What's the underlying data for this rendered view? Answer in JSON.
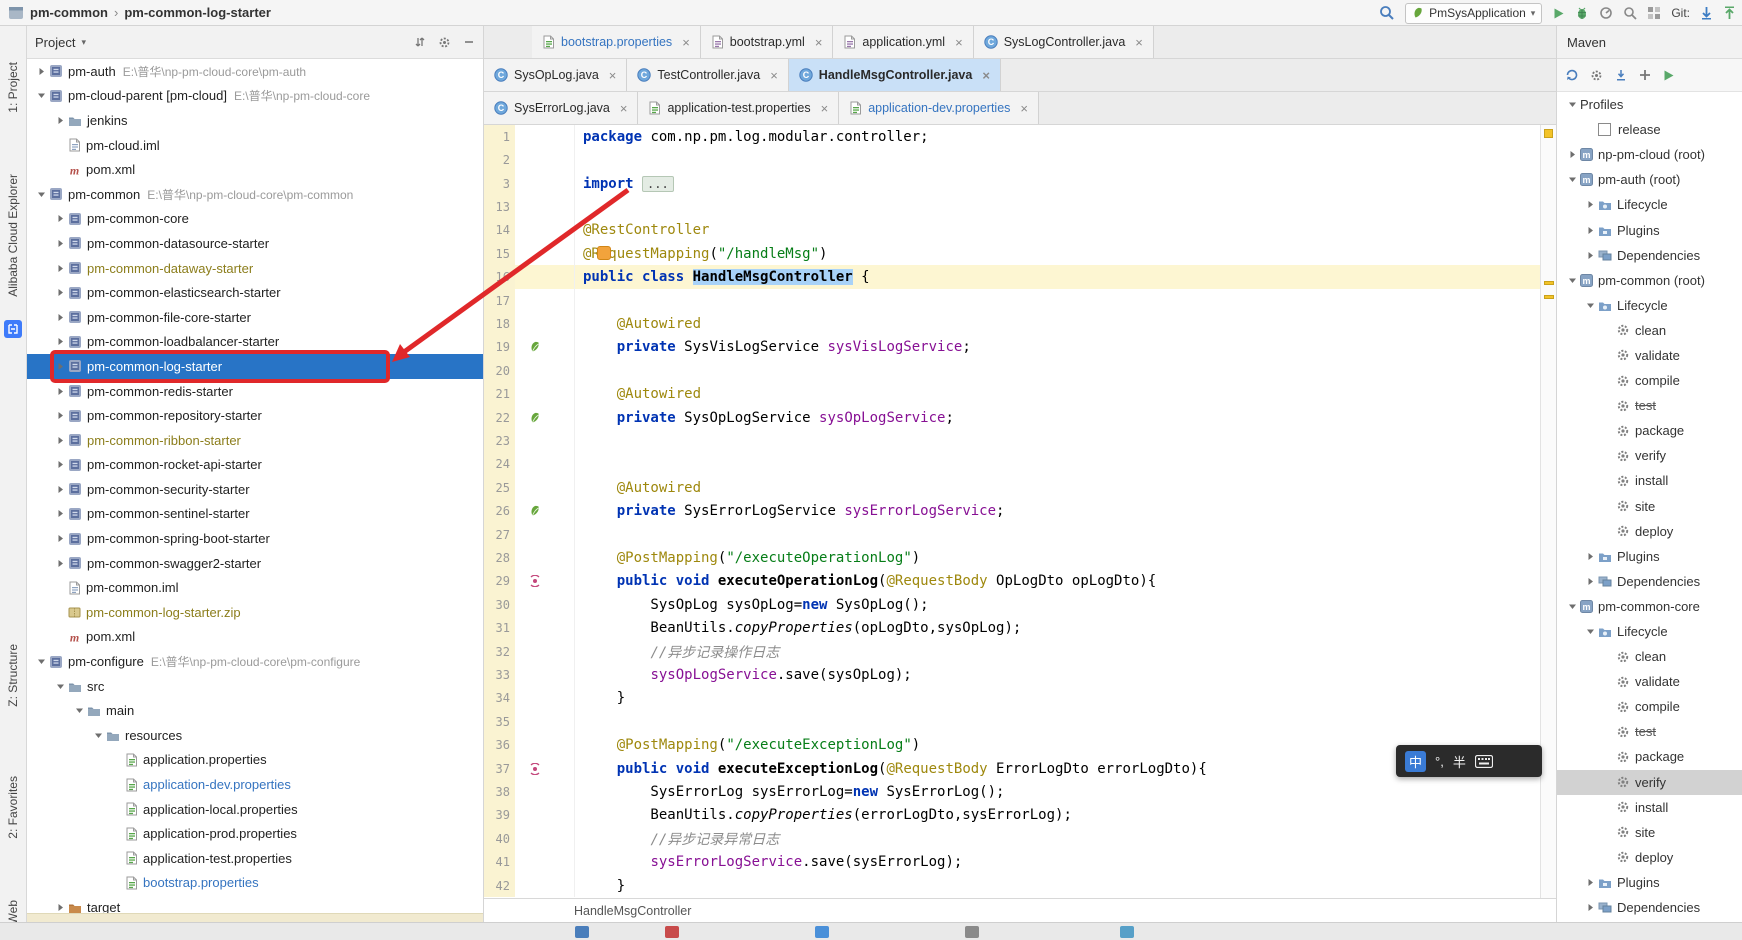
{
  "colors": {
    "selection_blue": "#2874c6",
    "annotation_red": "#e0282a",
    "active_tab": "#c9e0f7",
    "current_line": "#fdf6d2",
    "modified_file_blue": "#3574c0",
    "ignored_file_olive": "#8c7e1c"
  },
  "top_bar": {
    "breadcrumb": [
      "pm-common",
      "pm-common-log-starter"
    ],
    "run_config": "PmSysApplication",
    "git_label": "Git:"
  },
  "tool_stripe": {
    "items": [
      "1: Project",
      "Alibaba Cloud Explorer",
      "Z: Structure",
      "2: Favorites",
      "Web"
    ]
  },
  "project_panel": {
    "title": "Project",
    "tree": [
      {
        "label": "pm-auth",
        "path": "E:\\普华\\np-pm-cloud-core\\pm-auth",
        "level": 0,
        "chev": "r",
        "icon": "module"
      },
      {
        "label": "pm-cloud-parent [pm-cloud]",
        "path": "E:\\普华\\np-pm-cloud-core",
        "level": 0,
        "chev": "d",
        "icon": "module"
      },
      {
        "label": "jenkins",
        "level": 1,
        "chev": "r",
        "icon": "folder"
      },
      {
        "label": "pm-cloud.iml",
        "level": 1,
        "icon": "iml-file"
      },
      {
        "label": "pom.xml",
        "level": 1,
        "icon": "maven-pom"
      },
      {
        "label": "pm-common",
        "path": "E:\\普华\\np-pm-cloud-core\\pm-common",
        "level": 0,
        "chev": "d",
        "icon": "module"
      },
      {
        "label": "pm-common-core",
        "level": 1,
        "chev": "r",
        "icon": "module"
      },
      {
        "label": "pm-common-datasource-starter",
        "level": 1,
        "chev": "r",
        "icon": "module"
      },
      {
        "label": "pm-common-dataway-starter",
        "level": 1,
        "chev": "r",
        "icon": "module",
        "cls": "ign"
      },
      {
        "label": "pm-common-elasticsearch-starter",
        "level": 1,
        "chev": "r",
        "icon": "module"
      },
      {
        "label": "pm-common-file-core-starter",
        "level": 1,
        "chev": "r",
        "icon": "module"
      },
      {
        "label": "pm-common-loadbalancer-starter",
        "level": 1,
        "chev": "r",
        "icon": "module"
      },
      {
        "label": "pm-common-log-starter",
        "level": 1,
        "chev": "r",
        "icon": "module",
        "selected": true
      },
      {
        "label": "pm-common-redis-starter",
        "level": 1,
        "chev": "r",
        "icon": "module"
      },
      {
        "label": "pm-common-repository-starter",
        "level": 1,
        "chev": "r",
        "icon": "module"
      },
      {
        "label": "pm-common-ribbon-starter",
        "level": 1,
        "chev": "r",
        "icon": "module",
        "cls": "ign"
      },
      {
        "label": "pm-common-rocket-api-starter",
        "level": 1,
        "chev": "r",
        "icon": "module"
      },
      {
        "label": "pm-common-security-starter",
        "level": 1,
        "chev": "r",
        "icon": "module"
      },
      {
        "label": "pm-common-sentinel-starter",
        "level": 1,
        "chev": "r",
        "icon": "module"
      },
      {
        "label": "pm-common-spring-boot-starter",
        "level": 1,
        "chev": "r",
        "icon": "module"
      },
      {
        "label": "pm-common-swagger2-starter",
        "level": 1,
        "chev": "r",
        "icon": "module"
      },
      {
        "label": "pm-common.iml",
        "level": 1,
        "icon": "iml-file"
      },
      {
        "label": "pm-common-log-starter.zip",
        "level": 1,
        "icon": "zip-archive",
        "cls": "ign"
      },
      {
        "label": "pom.xml",
        "level": 1,
        "icon": "maven-pom"
      },
      {
        "label": "pm-configure",
        "path": "E:\\普华\\np-pm-cloud-core\\pm-configure",
        "level": 0,
        "chev": "d",
        "icon": "module"
      },
      {
        "label": "src",
        "level": 1,
        "chev": "d",
        "icon": "folder"
      },
      {
        "label": "main",
        "level": 2,
        "chev": "d",
        "icon": "folder"
      },
      {
        "label": "resources",
        "level": 3,
        "chev": "d",
        "icon": "folder"
      },
      {
        "label": "application.properties",
        "level": 4,
        "icon": "properties-file"
      },
      {
        "label": "application-dev.properties",
        "level": 4,
        "icon": "properties-file",
        "cls": "mod"
      },
      {
        "label": "application-local.properties",
        "level": 4,
        "icon": "properties-file"
      },
      {
        "label": "application-prod.properties",
        "level": 4,
        "icon": "properties-file"
      },
      {
        "label": "application-test.properties",
        "level": 4,
        "icon": "properties-file"
      },
      {
        "label": "bootstrap.properties",
        "level": 4,
        "icon": "properties-file",
        "cls": "mod"
      },
      {
        "label": "target",
        "level": 1,
        "chev": "r",
        "icon": "folder-excluded"
      }
    ]
  },
  "editor": {
    "tab_rows": [
      [
        {
          "label": "bootstrap.properties",
          "icon": "properties-file",
          "mod": true
        },
        {
          "label": "bootstrap.yml",
          "icon": "yaml-file"
        },
        {
          "label": "application.yml",
          "icon": "yaml-file"
        },
        {
          "label": "SysLogController.java",
          "icon": "java-class"
        }
      ],
      [
        {
          "label": "SysOpLog.java",
          "icon": "java-class"
        },
        {
          "label": "TestController.java",
          "icon": "java-class"
        },
        {
          "label": "HandleMsgController.java",
          "icon": "java-class",
          "active": true
        }
      ],
      [
        {
          "label": "SysErrorLog.java",
          "icon": "java-class"
        },
        {
          "label": "application-test.properties",
          "icon": "properties-file"
        },
        {
          "label": "application-dev.properties",
          "icon": "properties-file",
          "mod": true
        }
      ]
    ],
    "code_lines": [
      {
        "n": 1,
        "seg": [
          [
            "kw",
            "package"
          ],
          [
            "pl",
            " com.np.pm.log.modular.controller;"
          ]
        ]
      },
      {
        "n": 2,
        "seg": []
      },
      {
        "n": 3,
        "seg": [
          [
            "kw",
            "import"
          ],
          [
            "pl",
            " "
          ],
          [
            "fold",
            "..."
          ]
        ]
      },
      {
        "n": 13,
        "seg": []
      },
      {
        "n": 14,
        "seg": [
          [
            "ann",
            "@RestController"
          ]
        ]
      },
      {
        "n": 15,
        "seg": [
          [
            "ann",
            "@RequestMapping"
          ],
          [
            "pl",
            "("
          ],
          [
            "str",
            "\"/handleMsg\""
          ],
          [
            "pl",
            ")"
          ]
        ],
        "bulb": true
      },
      {
        "n": 16,
        "cur": true,
        "seg": [
          [
            "kw",
            "public class"
          ],
          [
            "pl",
            " "
          ],
          [
            "sel",
            "HandleMsgController"
          ],
          [
            "pl",
            " {"
          ]
        ]
      },
      {
        "n": 17,
        "seg": []
      },
      {
        "n": 18,
        "seg": [
          [
            "pl",
            "    "
          ],
          [
            "ann",
            "@Autowired"
          ]
        ]
      },
      {
        "n": 19,
        "g": "spring-bean",
        "seg": [
          [
            "pl",
            "    "
          ],
          [
            "kw",
            "private"
          ],
          [
            "pl",
            " SysVisLogService "
          ],
          [
            "field",
            "sysVisLogService"
          ],
          [
            "pl",
            ";"
          ]
        ]
      },
      {
        "n": 20,
        "seg": []
      },
      {
        "n": 21,
        "seg": [
          [
            "pl",
            "    "
          ],
          [
            "ann",
            "@Autowired"
          ]
        ]
      },
      {
        "n": 22,
        "g": "spring-bean",
        "seg": [
          [
            "pl",
            "    "
          ],
          [
            "kw",
            "private"
          ],
          [
            "pl",
            " SysOpLogService "
          ],
          [
            "field",
            "sysOpLogService"
          ],
          [
            "pl",
            ";"
          ]
        ]
      },
      {
        "n": 23,
        "seg": []
      },
      {
        "n": 24,
        "seg": []
      },
      {
        "n": 25,
        "seg": [
          [
            "pl",
            "    "
          ],
          [
            "ann",
            "@Autowired"
          ]
        ]
      },
      {
        "n": 26,
        "g": "spring-bean",
        "seg": [
          [
            "pl",
            "    "
          ],
          [
            "kw",
            "private"
          ],
          [
            "pl",
            " SysErrorLogService "
          ],
          [
            "field",
            "sysErrorLogService"
          ],
          [
            "pl",
            ";"
          ]
        ]
      },
      {
        "n": 27,
        "seg": []
      },
      {
        "n": 28,
        "seg": [
          [
            "pl",
            "    "
          ],
          [
            "ann",
            "@PostMapping"
          ],
          [
            "pl",
            "("
          ],
          [
            "str",
            "\"/executeOperationLog\""
          ],
          [
            "pl",
            ")"
          ]
        ]
      },
      {
        "n": 29,
        "g": "request-mapping",
        "seg": [
          [
            "pl",
            "    "
          ],
          [
            "kw",
            "public void"
          ],
          [
            "pl",
            " "
          ],
          [
            "mname",
            "executeOperationLog"
          ],
          [
            "pl",
            "("
          ],
          [
            "ann",
            "@RequestBody"
          ],
          [
            "pl",
            " OpLogDto opLogDto){"
          ]
        ]
      },
      {
        "n": 30,
        "seg": [
          [
            "pl",
            "        SysOpLog sysOpLog="
          ],
          [
            "kw",
            "new"
          ],
          [
            "pl",
            " SysOpLog();"
          ]
        ]
      },
      {
        "n": 31,
        "seg": [
          [
            "pl",
            "        BeanUtils."
          ],
          [
            "sm",
            "copyProperties"
          ],
          [
            "pl",
            "(opLogDto,sysOpLog);"
          ]
        ]
      },
      {
        "n": 32,
        "seg": [
          [
            "pl",
            "        "
          ],
          [
            "cmt",
            "//异步记录操作日志"
          ]
        ]
      },
      {
        "n": 33,
        "seg": [
          [
            "pl",
            "        "
          ],
          [
            "field",
            "sysOpLogService"
          ],
          [
            "pl",
            ".save(sysOpLog);"
          ]
        ]
      },
      {
        "n": 34,
        "seg": [
          [
            "pl",
            "    }"
          ]
        ]
      },
      {
        "n": 35,
        "seg": []
      },
      {
        "n": 36,
        "seg": [
          [
            "pl",
            "    "
          ],
          [
            "ann",
            "@PostMapping"
          ],
          [
            "pl",
            "("
          ],
          [
            "str",
            "\"/executeExceptionLog\""
          ],
          [
            "pl",
            ")"
          ]
        ]
      },
      {
        "n": 37,
        "g": "request-mapping",
        "seg": [
          [
            "pl",
            "    "
          ],
          [
            "kw",
            "public void"
          ],
          [
            "pl",
            " "
          ],
          [
            "mname",
            "executeExceptionLog"
          ],
          [
            "pl",
            "("
          ],
          [
            "ann",
            "@RequestBody"
          ],
          [
            "pl",
            " ErrorLogDto errorLogDto){"
          ]
        ]
      },
      {
        "n": 38,
        "seg": [
          [
            "pl",
            "        SysErrorLog sysErrorLog="
          ],
          [
            "kw",
            "new"
          ],
          [
            "pl",
            " SysErrorLog();"
          ]
        ]
      },
      {
        "n": 39,
        "seg": [
          [
            "pl",
            "        BeanUtils."
          ],
          [
            "sm",
            "copyProperties"
          ],
          [
            "pl",
            "(errorLogDto,sysErrorLog);"
          ]
        ]
      },
      {
        "n": 40,
        "seg": [
          [
            "pl",
            "        "
          ],
          [
            "cmt",
            "//异步记录异常日志"
          ]
        ]
      },
      {
        "n": 41,
        "seg": [
          [
            "pl",
            "        "
          ],
          [
            "field",
            "sysErrorLogService"
          ],
          [
            "pl",
            ".save(sysErrorLog);"
          ]
        ]
      },
      {
        "n": 42,
        "seg": [
          [
            "pl",
            "    }"
          ]
        ]
      }
    ],
    "breadcrumb": "HandleMsgController"
  },
  "maven_panel": {
    "title": "Maven",
    "tree": [
      {
        "label": "Profiles",
        "level": 0,
        "chev": "d"
      },
      {
        "label": "release",
        "level": 1,
        "checkbox": true
      },
      {
        "label": "np-pm-cloud (root)",
        "level": 0,
        "chev": "r",
        "icon": "maven-module"
      },
      {
        "label": "pm-auth (root)",
        "level": 0,
        "chev": "d",
        "icon": "maven-module"
      },
      {
        "label": "Lifecycle",
        "level": 1,
        "chev": "r",
        "icon": "lifecycle"
      },
      {
        "label": "Plugins",
        "level": 1,
        "chev": "r",
        "icon": "plugins"
      },
      {
        "label": "Dependencies",
        "level": 1,
        "chev": "r",
        "icon": "dependencies"
      },
      {
        "label": "pm-common (root)",
        "level": 0,
        "chev": "d",
        "icon": "maven-module"
      },
      {
        "label": "Lifecycle",
        "level": 1,
        "chev": "d",
        "icon": "lifecycle"
      },
      {
        "label": "clean",
        "level": 2,
        "icon": "goal"
      },
      {
        "label": "validate",
        "level": 2,
        "icon": "goal"
      },
      {
        "label": "compile",
        "level": 2,
        "icon": "goal"
      },
      {
        "label": "test",
        "level": 2,
        "icon": "goal",
        "strike": true
      },
      {
        "label": "package",
        "level": 2,
        "icon": "goal"
      },
      {
        "label": "verify",
        "level": 2,
        "icon": "goal"
      },
      {
        "label": "install",
        "level": 2,
        "icon": "goal"
      },
      {
        "label": "site",
        "level": 2,
        "icon": "goal"
      },
      {
        "label": "deploy",
        "level": 2,
        "icon": "goal"
      },
      {
        "label": "Plugins",
        "level": 1,
        "chev": "r",
        "icon": "plugins"
      },
      {
        "label": "Dependencies",
        "level": 1,
        "chev": "r",
        "icon": "dependencies"
      },
      {
        "label": "pm-common-core",
        "level": 0,
        "chev": "d",
        "icon": "maven-module"
      },
      {
        "label": "Lifecycle",
        "level": 1,
        "chev": "d",
        "icon": "lifecycle"
      },
      {
        "label": "clean",
        "level": 2,
        "icon": "goal"
      },
      {
        "label": "validate",
        "level": 2,
        "icon": "goal"
      },
      {
        "label": "compile",
        "level": 2,
        "icon": "goal"
      },
      {
        "label": "test",
        "level": 2,
        "icon": "goal",
        "strike": true
      },
      {
        "label": "package",
        "level": 2,
        "icon": "goal"
      },
      {
        "label": "verify",
        "level": 2,
        "icon": "goal",
        "selected": true
      },
      {
        "label": "install",
        "level": 2,
        "icon": "goal"
      },
      {
        "label": "site",
        "level": 2,
        "icon": "goal"
      },
      {
        "label": "deploy",
        "level": 2,
        "icon": "goal"
      },
      {
        "label": "Plugins",
        "level": 1,
        "chev": "r",
        "icon": "plugins"
      },
      {
        "label": "Dependencies",
        "level": 1,
        "chev": "r",
        "icon": "dependencies"
      }
    ]
  },
  "ime_popup": {
    "mode": "中",
    "punctuation": "°,",
    "width_mode": "半"
  }
}
